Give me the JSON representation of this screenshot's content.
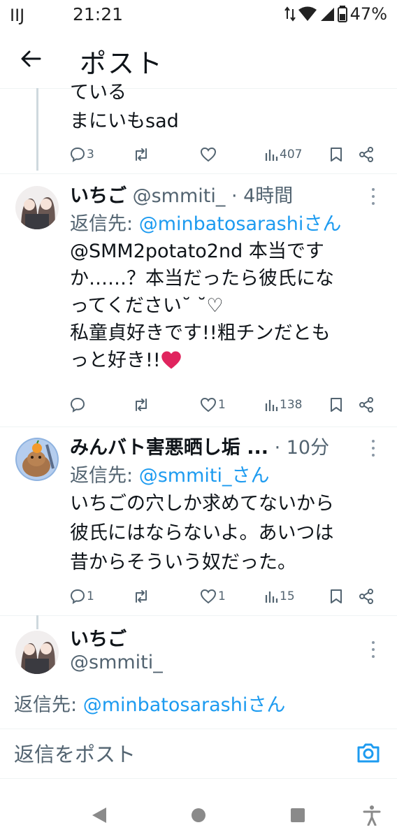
{
  "status_bar": {
    "carrier": "IIJ",
    "time": "21:21",
    "battery": "47%"
  },
  "header": {
    "title": "ポスト"
  },
  "colors": {
    "accent": "#1d9bf0",
    "heart": "#e0245e",
    "muted": "#536471"
  },
  "posts": [
    {
      "body_lines": [
        "ている",
        "まにいもsad"
      ],
      "replies": "3",
      "reposts": "",
      "likes": "",
      "views": "407"
    },
    {
      "name": "いちご",
      "handle": "@smmiti_",
      "time": "· 4時間",
      "reply_to_label": "返信先:",
      "reply_to_user": "@minbatosarashiさん",
      "body_lines": [
        "@SMM2potato2nd 本当です",
        "か……？本当だったら彼氏にな",
        "ってください˘ ˘♡",
        "私童貞好きです!!粗チンだとも",
        "っと好き!!"
      ],
      "heart_emoji": "❤️",
      "replies": "",
      "reposts": "",
      "likes": "1",
      "views": "138"
    },
    {
      "name": "みんバト害悪晒し垢 ...",
      "time": "· 10分",
      "reply_to_label": "返信先:",
      "reply_to_user": "@smmiti_さん",
      "body_lines": [
        "いちごの穴しか求めてないから",
        "彼氏にはならないよ。あいつは",
        "昔からそういう奴だった。"
      ],
      "replies": "1",
      "reposts": "",
      "likes": "1",
      "views": "15"
    }
  ],
  "composer": {
    "name": "いちご",
    "handle": "@smmiti_",
    "reply_to_label": "返信先:",
    "reply_to_user": "@minbatosarashiさん",
    "placeholder": "返信をポスト"
  }
}
